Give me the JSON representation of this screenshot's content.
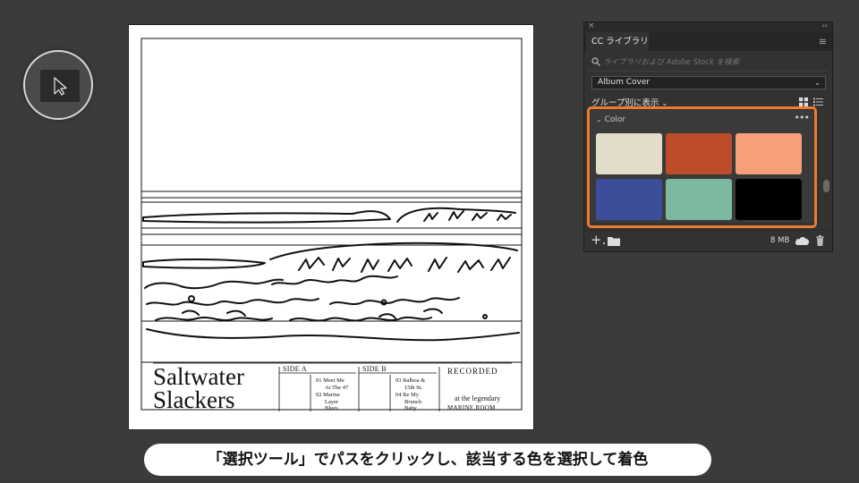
{
  "tool": {
    "icon": "selection-tool-icon"
  },
  "album": {
    "title_line1": "Saltwater",
    "title_line2": "Slackers",
    "side_a": {
      "label": "SIDE A",
      "tracks": [
        {
          "num": "01",
          "lines": [
            "Meet Me",
            "At The 47"
          ]
        },
        {
          "num": "02",
          "lines": [
            "Marine",
            "Layer",
            "Blues"
          ]
        }
      ]
    },
    "side_b": {
      "label": "SIDE B",
      "tracks": [
        {
          "num": "03",
          "lines": [
            "Balboa &",
            "15th St."
          ]
        },
        {
          "num": "04",
          "lines": [
            "Be My",
            "Brunch",
            "Baby"
          ]
        }
      ]
    },
    "recorded": {
      "label": "RECORDED",
      "at": "at the legendary",
      "venue": "MARINE ROOM"
    }
  },
  "panel": {
    "tab_label": "CC ライブラリ",
    "close_glyph": "×",
    "collapse_glyph": "‹‹",
    "menu_glyph": "≡",
    "search_placeholder": "ライブラリおよび Adobe Stock を検索",
    "selected_library": "Album Cover",
    "group_by_label": "グループ別に表示",
    "group_header": "Color",
    "more_glyph": "•••",
    "add_glyph": "+.",
    "storage": "8 MB",
    "swatches": [
      {
        "color": "#e2dccb"
      },
      {
        "color": "#bd4d28"
      },
      {
        "color": "#f5a078"
      },
      {
        "color": "#3c4e9a"
      },
      {
        "color": "#7cb9a0"
      },
      {
        "color": "#000000"
      }
    ]
  },
  "highlight_color": "#ee7a2d",
  "caption": "「選択ツール」でパスをクリックし、該当する色を選択して着色"
}
